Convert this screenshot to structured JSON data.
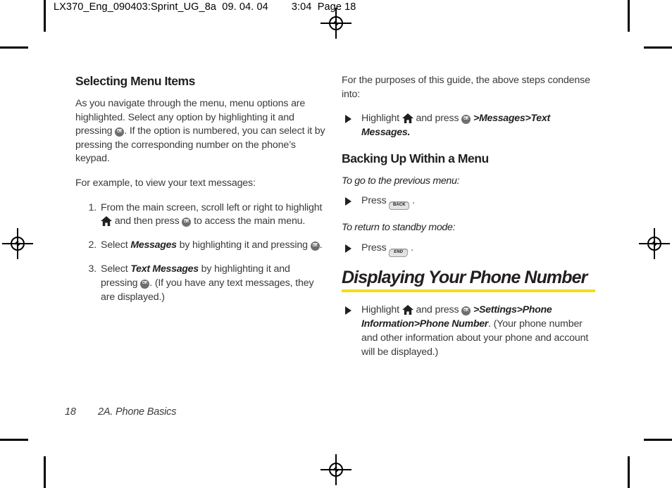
{
  "prepress": {
    "header_line": "LX370_Eng_090403:Sprint_UG_8a  09. 04. 04        3:04  Page 18",
    "registration_mark": "registration-target-icon",
    "gold_rule_color": "#f5dd16"
  },
  "left_column": {
    "heading": "Selecting Menu Items",
    "intro_part1": "As you navigate through the menu, menu options are highlighted. Select any option by highlighting it and pressing",
    "intro_part2": ". If the option is numbered, you can select it by pressing the corresponding number on the phone’s keypad.",
    "example_lead": "For example, to view your text messages:",
    "steps": [
      {
        "num": "1.",
        "part1": "From the main screen, scroll left or right to highlight",
        "part2": "and then press",
        "part3": "to access the main menu."
      },
      {
        "num": "2.",
        "part1": "Select",
        "emphasis": "Messages",
        "part2": "by highlighting it and pressing",
        "part3": "."
      },
      {
        "num": "3.",
        "part1": "Select",
        "emphasis": "Text Messages",
        "part2": "by highlighting it and pressing",
        "part3": ". (If you have any text messages, they are displayed.)"
      }
    ]
  },
  "right_column": {
    "condense_intro": "For the purposes of this guide, the above steps condense into:",
    "condense_bullet": {
      "part1": "Highlight",
      "part2": "and press",
      "part3": ">",
      "emphasis1": "Messages",
      "part4": ">",
      "emphasis2": "Text Messages",
      "part5": "."
    },
    "backing_up": {
      "heading": "Backing Up Within a Menu",
      "lead_previous": "To go to the previous menu:",
      "press_label_previous": "Press",
      "key_previous": "BACK",
      "period_previous": ".",
      "lead_standby": "To return to standby mode:",
      "press_label_standby": "Press",
      "key_standby": "END",
      "period_standby": "."
    },
    "displaying": {
      "heading": "Displaying Your Phone Number",
      "bullet": {
        "part1": "Highlight",
        "part2": "and press",
        "part3": ">",
        "emphasis1": "Settings",
        "part4": ">",
        "emphasis2": "Phone Information",
        "part5": ">",
        "emphasis3": "Phone Number",
        "part6": ". (Your phone number and other information about your phone and account will be displayed.)"
      }
    }
  },
  "footer": {
    "page_number": "18",
    "section_title": "2A. Phone Basics"
  }
}
